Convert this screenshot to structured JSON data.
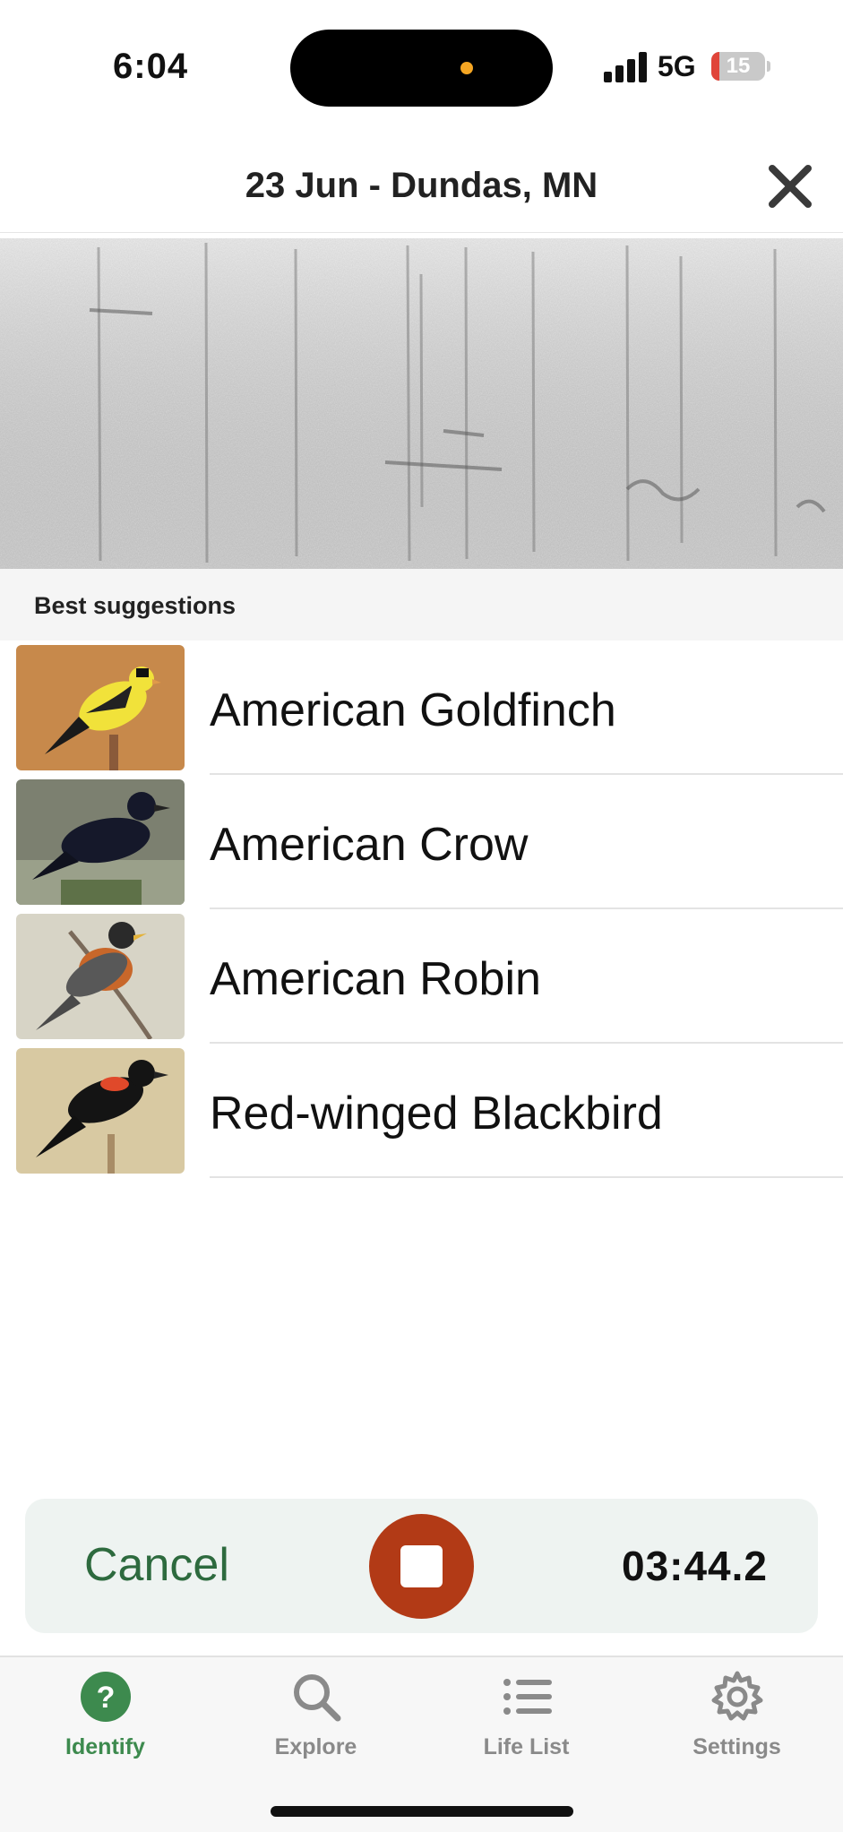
{
  "status": {
    "time": "6:04",
    "network": "5G",
    "battery": "15"
  },
  "header": {
    "title": "23 Jun - Dundas, MN"
  },
  "suggestions": {
    "title": "Best suggestions",
    "items": [
      {
        "name": "American Goldfinch",
        "icon": "goldfinch-photo"
      },
      {
        "name": "American Crow",
        "icon": "crow-photo"
      },
      {
        "name": "American Robin",
        "icon": "robin-photo"
      },
      {
        "name": "Red-winged Blackbird",
        "icon": "red-winged-blackbird-photo"
      }
    ]
  },
  "recorder": {
    "cancel_label": "Cancel",
    "elapsed": "03:44.2"
  },
  "tabs": [
    {
      "label": "Identify",
      "icon": "question-circle-icon",
      "active": true
    },
    {
      "label": "Explore",
      "icon": "search-icon",
      "active": false
    },
    {
      "label": "Life List",
      "icon": "list-icon",
      "active": false
    },
    {
      "label": "Settings",
      "icon": "gear-icon",
      "active": false
    }
  ],
  "colors": {
    "accent": "#3d8a4e",
    "stop": "#b23a16",
    "panel": "#eef3f1"
  }
}
